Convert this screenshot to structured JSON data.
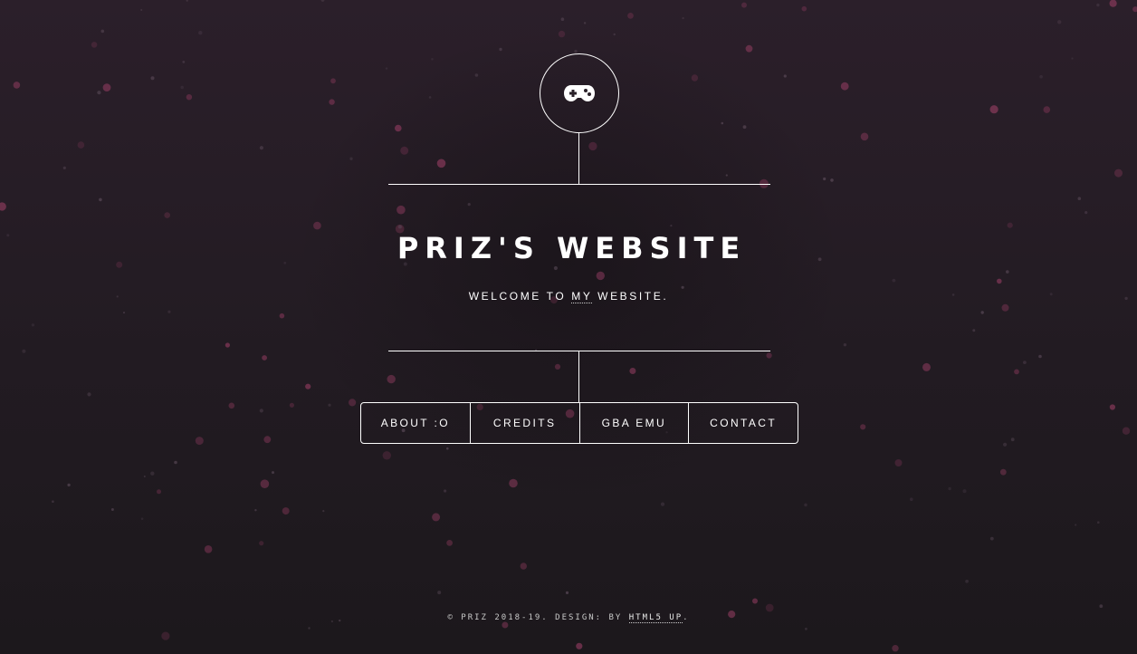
{
  "logo": {
    "icon": "gamepad-icon"
  },
  "header": {
    "title": "PRIZ'S WEBSITE",
    "subtitle_before": "WELCOME TO ",
    "subtitle_emphasis": "MY",
    "subtitle_after": " WEBSITE."
  },
  "nav": {
    "items": [
      {
        "label": "ABOUT :O"
      },
      {
        "label": "CREDITS"
      },
      {
        "label": "GBA EMU"
      },
      {
        "label": "CONTACT"
      }
    ]
  },
  "footer": {
    "copyright": "© PRIZ 2018-19. DESIGN: BY ",
    "link_label": "HTML5 UP",
    "end": "."
  },
  "colors": {
    "background_top": "#2b1f2a",
    "background_bottom": "#1c181c",
    "line": "#ffffff",
    "particle": "#8a3a5c"
  }
}
